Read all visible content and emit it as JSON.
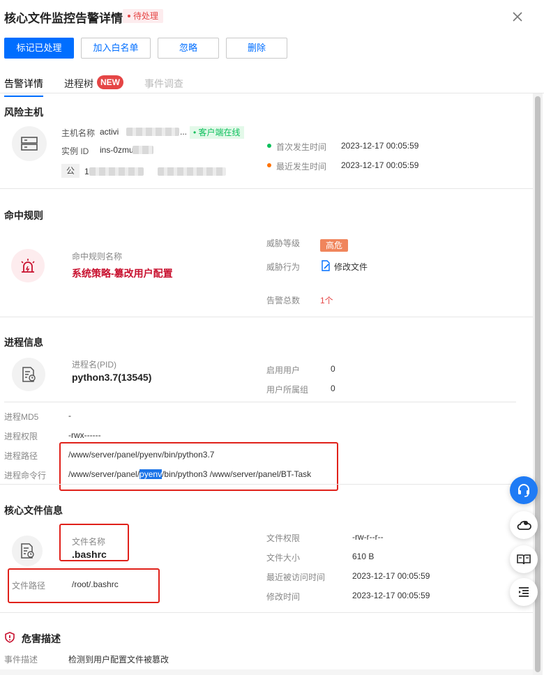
{
  "header": {
    "title": "核心文件监控告警详情",
    "status": "待处理"
  },
  "toolbar": {
    "mark_handled": "标记已处理",
    "add_whitelist": "加入白名单",
    "ignore": "忽略",
    "delete": "删除"
  },
  "tabs": [
    {
      "label": "告警详情"
    },
    {
      "label": "进程树",
      "badge": "NEW"
    },
    {
      "label": "事件调查"
    }
  ],
  "host": {
    "section_title": "风险主机",
    "name_label": "主机名称",
    "name_value": "activi",
    "name_ellipsis": "...",
    "online_status": "客户端在线",
    "instance_label": "实例 ID",
    "instance_value": "ins-0zmu",
    "public_ip_tag": "公",
    "public_ip_prefix": "1",
    "first_time_label": "首次发生时间",
    "first_time_value": "2023-12-17 00:05:59",
    "last_time_label": "最近发生时间",
    "last_time_value": "2023-12-17 00:05:59"
  },
  "rule": {
    "section_title": "命中规则",
    "name_label": "命中规则名称",
    "name_value": "系统策略-篡改用户配置",
    "threat_level_label": "威胁等级",
    "threat_level_value": "高危",
    "threat_behavior_label": "威胁行为",
    "threat_behavior_value": "修改文件",
    "alert_total_label": "告警总数",
    "alert_total_value": "1个"
  },
  "process": {
    "section_title": "进程信息",
    "name_label": "进程名(PID)",
    "name_value": "python3.7(13545)",
    "start_user_label": "启用用户",
    "start_user_value": "0",
    "user_group_label": "用户所属组",
    "user_group_value": "0",
    "md5_label": "进程MD5",
    "md5_value": "-",
    "perm_label": "进程权限",
    "perm_value": "-rwx------",
    "path_label": "进程路径",
    "path_value": "/www/server/panel/pyenv/bin/python3.7",
    "cmd_label": "进程命令行",
    "cmd_prefix": "/www/server/panel/",
    "cmd_highlight": "pyenv",
    "cmd_suffix": "/bin/python3 /www/server/panel/BT-Task"
  },
  "file": {
    "section_title": "核心文件信息",
    "name_label": "文件名称",
    "name_value": ".bashrc",
    "path_label": "文件路径",
    "path_value": "/root/.bashrc",
    "perm_label": "文件权限",
    "perm_value": "-rw-r--r--",
    "size_label": "文件大小",
    "size_value": "610 B",
    "access_label": "最近被访问时间",
    "access_value": "2023-12-17 00:05:59",
    "modify_label": "修改时间",
    "modify_value": "2023-12-17 00:05:59"
  },
  "harm": {
    "section_title": "危害描述",
    "event_label": "事件描述",
    "event_value": "检测到用户配置文件被篡改"
  },
  "colors": {
    "primary": "#006eff",
    "danger": "#e54545",
    "success": "#0abf5b",
    "warning": "#ff7200",
    "annotation": "#e0211a"
  }
}
